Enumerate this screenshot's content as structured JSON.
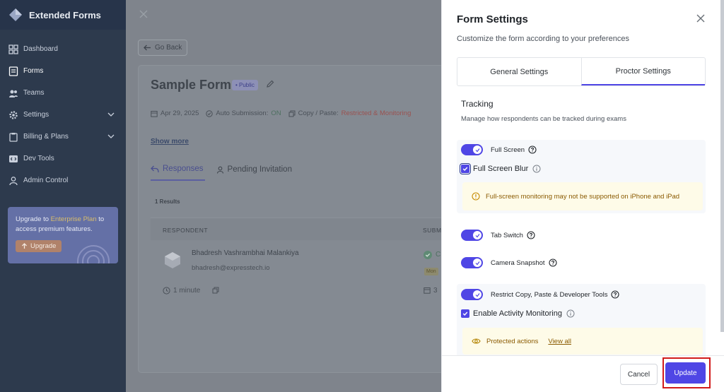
{
  "app": {
    "name": "Extended Forms"
  },
  "sidebar": {
    "items": [
      {
        "label": "Dashboard",
        "icon": "dashboard-icon"
      },
      {
        "label": "Forms",
        "icon": "document-icon"
      },
      {
        "label": "Teams",
        "icon": "team-icon"
      },
      {
        "label": "Settings",
        "icon": "gear-icon"
      },
      {
        "label": "Billing & Plans",
        "icon": "clipboard-icon"
      },
      {
        "label": "Dev Tools",
        "icon": "code-icon"
      },
      {
        "label": "Admin Control",
        "icon": "user-icon"
      }
    ],
    "upgrade": {
      "text_before": "Upgrade to ",
      "highlight": "Enterprise Plan",
      "text_after": " to access premium features.",
      "button": "Upgrade"
    }
  },
  "main": {
    "go_back": "Go Back",
    "form_title": "Sample Form",
    "badge": "• Public",
    "meta": {
      "date": "Apr 29, 2025",
      "auto_label": "Auto Submission:",
      "auto_value": "ON",
      "copy_label": "Copy / Paste:",
      "copy_value": "Restricted & Monitoring"
    },
    "show_more": "Show more",
    "tabs": [
      {
        "label": "Responses"
      },
      {
        "label": "Pending Invitation"
      }
    ],
    "results_count": "1 Results",
    "table": {
      "headers": [
        "RESPONDENT",
        "SUBM"
      ],
      "row": {
        "name": "Bhadresh Vashrambhai Malankiya",
        "email": "bhadresh@expresstech.io",
        "duration": "1 minute",
        "status": "C",
        "tag": "Mon",
        "date": "3"
      }
    }
  },
  "panel": {
    "title": "Form Settings",
    "subtitle": "Customize the form according to your preferences",
    "tabs": [
      {
        "label": "General Settings"
      },
      {
        "label": "Proctor Settings"
      }
    ],
    "tracking": {
      "heading": "Tracking",
      "description": "Manage how respondents can be tracked during exams"
    },
    "full_screen": {
      "label": "Full Screen",
      "enabled": true
    },
    "full_screen_blur": {
      "label": "Full Screen Blur",
      "checked": true
    },
    "full_screen_alert": "Full-screen monitoring may not be supported on iPhone and iPad",
    "tab_switch": {
      "label": "Tab Switch",
      "enabled": true
    },
    "camera_snapshot": {
      "label": "Camera Snapshot",
      "enabled": true
    },
    "restrict_copy": {
      "label": "Restrict Copy, Paste & Developer Tools",
      "enabled": true
    },
    "activity_monitoring": {
      "label": "Enable Activity Monitoring",
      "checked": true
    },
    "protected_actions": {
      "label": "Protected actions",
      "link": "View all"
    },
    "buttons": {
      "cancel": "Cancel",
      "update": "Update"
    }
  },
  "colors": {
    "accent": "#4f46e5",
    "highlight_frame": "#d11a1a",
    "sidebar_bg": "#2d3a4d"
  }
}
